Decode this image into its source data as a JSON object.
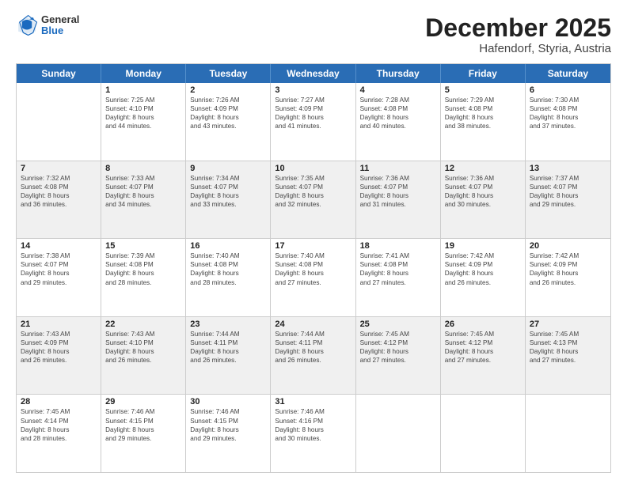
{
  "logo": {
    "general": "General",
    "blue": "Blue"
  },
  "header": {
    "month": "December 2025",
    "location": "Hafendorf, Styria, Austria"
  },
  "days": [
    "Sunday",
    "Monday",
    "Tuesday",
    "Wednesday",
    "Thursday",
    "Friday",
    "Saturday"
  ],
  "rows": [
    [
      {
        "day": "",
        "lines": []
      },
      {
        "day": "1",
        "lines": [
          "Sunrise: 7:25 AM",
          "Sunset: 4:10 PM",
          "Daylight: 8 hours",
          "and 44 minutes."
        ]
      },
      {
        "day": "2",
        "lines": [
          "Sunrise: 7:26 AM",
          "Sunset: 4:09 PM",
          "Daylight: 8 hours",
          "and 43 minutes."
        ]
      },
      {
        "day": "3",
        "lines": [
          "Sunrise: 7:27 AM",
          "Sunset: 4:09 PM",
          "Daylight: 8 hours",
          "and 41 minutes."
        ]
      },
      {
        "day": "4",
        "lines": [
          "Sunrise: 7:28 AM",
          "Sunset: 4:08 PM",
          "Daylight: 8 hours",
          "and 40 minutes."
        ]
      },
      {
        "day": "5",
        "lines": [
          "Sunrise: 7:29 AM",
          "Sunset: 4:08 PM",
          "Daylight: 8 hours",
          "and 38 minutes."
        ]
      },
      {
        "day": "6",
        "lines": [
          "Sunrise: 7:30 AM",
          "Sunset: 4:08 PM",
          "Daylight: 8 hours",
          "and 37 minutes."
        ]
      }
    ],
    [
      {
        "day": "7",
        "lines": [
          "Sunrise: 7:32 AM",
          "Sunset: 4:08 PM",
          "Daylight: 8 hours",
          "and 36 minutes."
        ]
      },
      {
        "day": "8",
        "lines": [
          "Sunrise: 7:33 AM",
          "Sunset: 4:07 PM",
          "Daylight: 8 hours",
          "and 34 minutes."
        ]
      },
      {
        "day": "9",
        "lines": [
          "Sunrise: 7:34 AM",
          "Sunset: 4:07 PM",
          "Daylight: 8 hours",
          "and 33 minutes."
        ]
      },
      {
        "day": "10",
        "lines": [
          "Sunrise: 7:35 AM",
          "Sunset: 4:07 PM",
          "Daylight: 8 hours",
          "and 32 minutes."
        ]
      },
      {
        "day": "11",
        "lines": [
          "Sunrise: 7:36 AM",
          "Sunset: 4:07 PM",
          "Daylight: 8 hours",
          "and 31 minutes."
        ]
      },
      {
        "day": "12",
        "lines": [
          "Sunrise: 7:36 AM",
          "Sunset: 4:07 PM",
          "Daylight: 8 hours",
          "and 30 minutes."
        ]
      },
      {
        "day": "13",
        "lines": [
          "Sunrise: 7:37 AM",
          "Sunset: 4:07 PM",
          "Daylight: 8 hours",
          "and 29 minutes."
        ]
      }
    ],
    [
      {
        "day": "14",
        "lines": [
          "Sunrise: 7:38 AM",
          "Sunset: 4:07 PM",
          "Daylight: 8 hours",
          "and 29 minutes."
        ]
      },
      {
        "day": "15",
        "lines": [
          "Sunrise: 7:39 AM",
          "Sunset: 4:08 PM",
          "Daylight: 8 hours",
          "and 28 minutes."
        ]
      },
      {
        "day": "16",
        "lines": [
          "Sunrise: 7:40 AM",
          "Sunset: 4:08 PM",
          "Daylight: 8 hours",
          "and 28 minutes."
        ]
      },
      {
        "day": "17",
        "lines": [
          "Sunrise: 7:40 AM",
          "Sunset: 4:08 PM",
          "Daylight: 8 hours",
          "and 27 minutes."
        ]
      },
      {
        "day": "18",
        "lines": [
          "Sunrise: 7:41 AM",
          "Sunset: 4:08 PM",
          "Daylight: 8 hours",
          "and 27 minutes."
        ]
      },
      {
        "day": "19",
        "lines": [
          "Sunrise: 7:42 AM",
          "Sunset: 4:09 PM",
          "Daylight: 8 hours",
          "and 26 minutes."
        ]
      },
      {
        "day": "20",
        "lines": [
          "Sunrise: 7:42 AM",
          "Sunset: 4:09 PM",
          "Daylight: 8 hours",
          "and 26 minutes."
        ]
      }
    ],
    [
      {
        "day": "21",
        "lines": [
          "Sunrise: 7:43 AM",
          "Sunset: 4:09 PM",
          "Daylight: 8 hours",
          "and 26 minutes."
        ]
      },
      {
        "day": "22",
        "lines": [
          "Sunrise: 7:43 AM",
          "Sunset: 4:10 PM",
          "Daylight: 8 hours",
          "and 26 minutes."
        ]
      },
      {
        "day": "23",
        "lines": [
          "Sunrise: 7:44 AM",
          "Sunset: 4:11 PM",
          "Daylight: 8 hours",
          "and 26 minutes."
        ]
      },
      {
        "day": "24",
        "lines": [
          "Sunrise: 7:44 AM",
          "Sunset: 4:11 PM",
          "Daylight: 8 hours",
          "and 26 minutes."
        ]
      },
      {
        "day": "25",
        "lines": [
          "Sunrise: 7:45 AM",
          "Sunset: 4:12 PM",
          "Daylight: 8 hours",
          "and 27 minutes."
        ]
      },
      {
        "day": "26",
        "lines": [
          "Sunrise: 7:45 AM",
          "Sunset: 4:12 PM",
          "Daylight: 8 hours",
          "and 27 minutes."
        ]
      },
      {
        "day": "27",
        "lines": [
          "Sunrise: 7:45 AM",
          "Sunset: 4:13 PM",
          "Daylight: 8 hours",
          "and 27 minutes."
        ]
      }
    ],
    [
      {
        "day": "28",
        "lines": [
          "Sunrise: 7:45 AM",
          "Sunset: 4:14 PM",
          "Daylight: 8 hours",
          "and 28 minutes."
        ]
      },
      {
        "day": "29",
        "lines": [
          "Sunrise: 7:46 AM",
          "Sunset: 4:15 PM",
          "Daylight: 8 hours",
          "and 29 minutes."
        ]
      },
      {
        "day": "30",
        "lines": [
          "Sunrise: 7:46 AM",
          "Sunset: 4:15 PM",
          "Daylight: 8 hours",
          "and 29 minutes."
        ]
      },
      {
        "day": "31",
        "lines": [
          "Sunrise: 7:46 AM",
          "Sunset: 4:16 PM",
          "Daylight: 8 hours",
          "and 30 minutes."
        ]
      },
      {
        "day": "",
        "lines": []
      },
      {
        "day": "",
        "lines": []
      },
      {
        "day": "",
        "lines": []
      }
    ]
  ]
}
